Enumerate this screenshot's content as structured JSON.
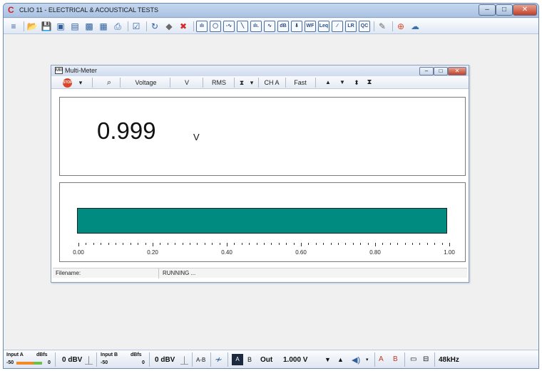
{
  "window": {
    "title": "CLIO 11 - ELECTRICAL & ACOUSTICAL TESTS",
    "controls": [
      "–",
      "□",
      "✕"
    ]
  },
  "toolbar": {
    "items": [
      {
        "name": "menu-icon",
        "glyph": "≡",
        "color": "#3b5f95"
      },
      {
        "name": "open-folder-icon",
        "glyph": "📂",
        "color": "#d98b1f"
      },
      {
        "name": "save-icon",
        "glyph": "💾",
        "color": "#2e5e9e"
      },
      {
        "name": "save-as-icon",
        "glyph": "▣",
        "color": "#2e5e9e"
      },
      {
        "name": "export-icon",
        "glyph": "▤",
        "color": "#2e5e9e"
      },
      {
        "name": "image-icon",
        "glyph": "▩",
        "color": "#2e5e9e"
      },
      {
        "name": "calendar-icon",
        "glyph": "▦",
        "color": "#2e5e9e"
      },
      {
        "name": "print-icon",
        "glyph": "⎙",
        "color": "#2e5e9e"
      },
      {
        "name": "check-icon",
        "glyph": "☑",
        "color": "#2e5e9e"
      },
      {
        "name": "refresh-icon",
        "glyph": "↻",
        "color": "#2e5e9e"
      },
      {
        "name": "eraser-icon",
        "glyph": "◆",
        "color": "#6a6a6a"
      },
      {
        "name": "delete-icon",
        "glyph": "✖",
        "color": "#d62a2a"
      }
    ],
    "measure_buttons": [
      {
        "name": "fft-button",
        "text": "ılı"
      },
      {
        "name": "mls-button",
        "text": "◯"
      },
      {
        "name": "sinusoidal-button",
        "text": "-∿"
      },
      {
        "name": "sweep-button",
        "text": "╲"
      },
      {
        "name": "rta-button",
        "text": "ılı."
      },
      {
        "name": "wave-button",
        "text": "∿"
      },
      {
        "name": "thd-button",
        "text": "dB"
      },
      {
        "name": "multimeter-button",
        "text": "⬇"
      },
      {
        "name": "wf-button",
        "text": "WF"
      },
      {
        "name": "leq-button",
        "text": "Leq"
      },
      {
        "name": "line-button",
        "text": "∕"
      },
      {
        "name": "lr-button",
        "text": "LR"
      },
      {
        "name": "qc-button",
        "text": "QC"
      }
    ],
    "trailing": [
      {
        "name": "pen-icon",
        "glyph": "✎",
        "color": "#6a6a6a"
      },
      {
        "name": "help-lifebuoy-icon",
        "glyph": "⊕",
        "color": "#d94a28"
      },
      {
        "name": "cloud-settings-icon",
        "glyph": "☁",
        "color": "#3b6fb0"
      }
    ]
  },
  "multimeter": {
    "title": "Multi-Meter",
    "icon_text": "MM",
    "stop_label": "STOP",
    "toolbar": {
      "quantity": "Voltage",
      "unit": "V",
      "mode": "RMS",
      "channel": "CH A",
      "speed": "Fast"
    },
    "reading": "0.999",
    "reading_unit": "V",
    "level_fraction": 0.999,
    "bar_color": "#008b80",
    "scale_labels": [
      "0.00",
      "0.20",
      "0.40",
      "0.60",
      "0.80",
      "1.00"
    ],
    "status": {
      "filename_label": "Filename:",
      "state": "RUNNING ..."
    }
  },
  "bottom": {
    "input_a_label": "Input A",
    "input_a_unit": "dBfs",
    "input_a_min": "-50",
    "input_a_max": "0",
    "input_a_sens": "0 dBV",
    "input_b_label": "Input B",
    "input_b_unit": "dBfs",
    "input_b_min": "-50",
    "input_b_max": "0",
    "input_b_sens": "0 dBV",
    "ab_label": "A-B",
    "ch_a_label": "A",
    "ch_b_label": "B",
    "out_label": "Out",
    "out_level": "1.000 V",
    "sample_rate": "48kHz"
  }
}
